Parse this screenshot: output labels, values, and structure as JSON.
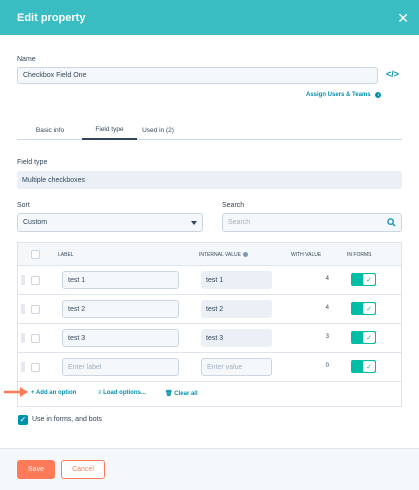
{
  "header": {
    "title": "Edit property",
    "close_icon": "close-icon"
  },
  "name": {
    "label": "Name",
    "value": "Checkbox Field One",
    "code_icon": "code-icon"
  },
  "assign_link": "Assign Users & Teams",
  "tabs": [
    {
      "label": "Basic info"
    },
    {
      "label": "Field type"
    },
    {
      "label": "Used in (2)"
    }
  ],
  "field_type": {
    "label": "Field type",
    "value": "Multiple checkboxes"
  },
  "sort": {
    "label": "Sort",
    "value": "Custom"
  },
  "search": {
    "label": "Search",
    "placeholder": "Search"
  },
  "table": {
    "headers": {
      "label": "LABEL",
      "internal_value": "INTERNAL VALUE",
      "with_value": "WITH VALUE",
      "in_forms": "IN FORMS"
    },
    "rows": [
      {
        "label": "test 1",
        "internal": "test 1",
        "count": "4"
      },
      {
        "label": "test 2",
        "internal": "test 2",
        "count": "4"
      },
      {
        "label": "test 3",
        "internal": "test 3",
        "count": "3"
      },
      {
        "label_placeholder": "Enter label",
        "internal_placeholder": "Enter value",
        "count": "0"
      }
    ],
    "actions": {
      "add": "Add an option",
      "load": "Load options...",
      "clear": "Clear all"
    }
  },
  "use_in_forms": "Use in forms, and bots",
  "footer": {
    "save": "Save",
    "cancel": "Cancel"
  },
  "colors": {
    "header": "#39bdc2",
    "accent": "#ff7a59",
    "toggle": "#00bda5",
    "link": "#0091ae"
  }
}
